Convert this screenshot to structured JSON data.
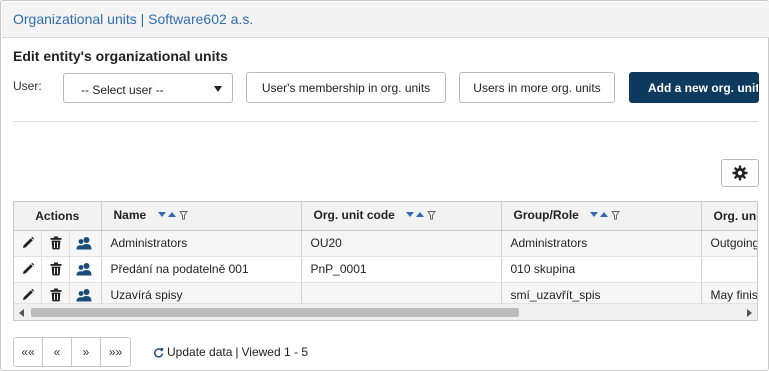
{
  "header": {
    "title": "Organizational units | Software602 a.s."
  },
  "section": {
    "title": "Edit entity's organizational units"
  },
  "user_filter": {
    "label": "User:",
    "selected": "-- Select user --"
  },
  "buttons": {
    "membership": "User's membership in org. units",
    "more": "Users in more org. units",
    "add": "Add a new org. unit"
  },
  "table": {
    "columns": {
      "actions": "Actions",
      "name": "Name",
      "code": "Org. unit code",
      "group": "Group/Role",
      "org": "Org. uni"
    },
    "rows": [
      {
        "name": "Administrators",
        "code": "OU20",
        "group": "Administrators",
        "org": "Outgoing"
      },
      {
        "name": "Předání na podatelně 001",
        "code": "PnP_0001",
        "group": "010 skupina",
        "org": ""
      },
      {
        "name": "Uzavírá spisy",
        "code": "",
        "group": "smí_uzavřít_spis",
        "org": "May finis"
      }
    ]
  },
  "pager": {
    "first": "««",
    "prev": "«",
    "next": "»",
    "last": "»»"
  },
  "status": {
    "update": "Update data",
    "separator": "|",
    "viewed": "Viewed 1 - 5"
  },
  "colors": {
    "accent": "#2f6db0",
    "primary_button": "#0d3a5e",
    "sort_arrow": "#2f6db0"
  }
}
